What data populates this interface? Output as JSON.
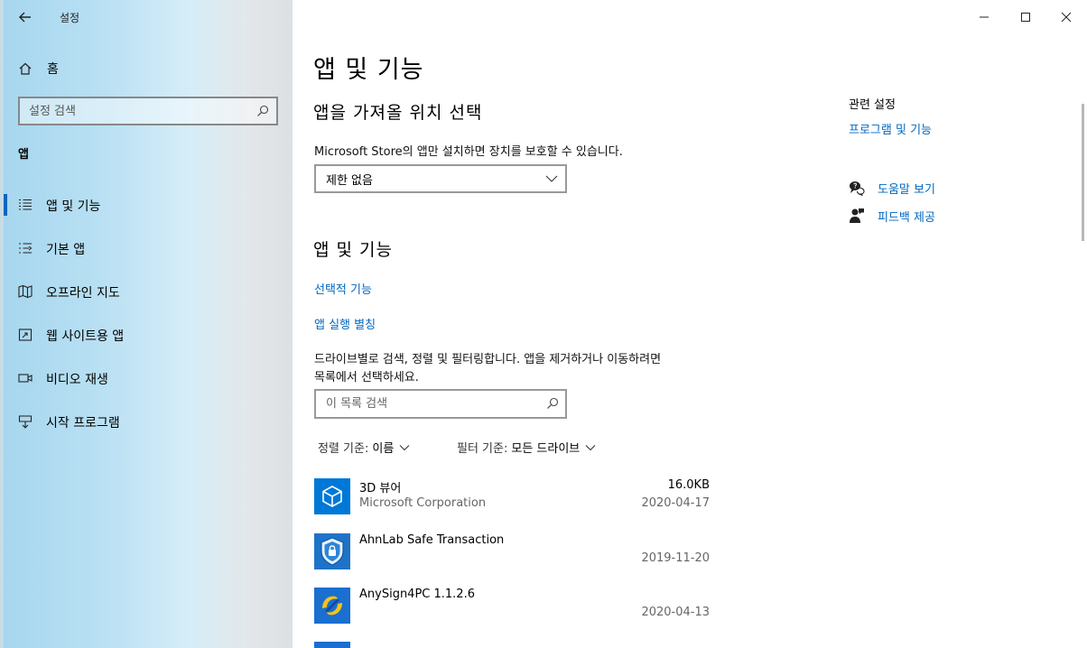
{
  "window": {
    "title": "설정",
    "controls": {
      "minimize": "minimize-icon",
      "maximize": "maximize-icon",
      "close": "close-icon"
    }
  },
  "sidebar": {
    "home_label": "홈",
    "search_placeholder": "설정 검색",
    "section_title": "앱",
    "items": [
      {
        "label": "앱 및 기능",
        "icon": "list-icon",
        "active": true
      },
      {
        "label": "기본 앱",
        "icon": "default-apps-icon",
        "active": false
      },
      {
        "label": "오프라인 지도",
        "icon": "map-icon",
        "active": false
      },
      {
        "label": "웹 사이트용 앱",
        "icon": "website-icon",
        "active": false
      },
      {
        "label": "비디오 재생",
        "icon": "video-icon",
        "active": false
      },
      {
        "label": "시작 프로그램",
        "icon": "startup-icon",
        "active": false
      }
    ]
  },
  "main": {
    "page_title": "앱 및 기능",
    "install_section": {
      "heading": "앱을 가져올 위치 선택",
      "description": "Microsoft Store의 앱만 설치하면 장치를 보호할 수 있습니다.",
      "dropdown_value": "제한 없음"
    },
    "apps_section": {
      "heading": "앱 및 기능",
      "link_optional": "선택적 기능",
      "link_aliases": "앱 실행 별칭",
      "description_line1": "드라이브별로 검색, 정렬 및 필터링합니다. 앱을 제거하거나 이동하려면",
      "description_line2": "목록에서 선택하세요.",
      "search_placeholder": "이 목록 검색",
      "sort_key": "정렬 기준:",
      "sort_value": "이름",
      "filter_key": "필터 기준:",
      "filter_value": "모든 드라이브",
      "apps": [
        {
          "name": "3D 뷰어",
          "publisher": "Microsoft Corporation",
          "size": "16.0KB",
          "date": "2020-04-17",
          "icon": "3d-viewer-icon",
          "color": "#0078d7"
        },
        {
          "name": "AhnLab Safe Transaction",
          "publisher": "",
          "size": "",
          "date": "2019-11-20",
          "icon": "ahnlab-shield-icon",
          "color": "#1e73c8"
        },
        {
          "name": "AnySign4PC 1.1.2.6",
          "publisher": "",
          "size": "",
          "date": "2020-04-13",
          "icon": "anysign-icon",
          "color": "#1a6fd0"
        }
      ]
    }
  },
  "related": {
    "title": "관련 설정",
    "programs_link": "프로그램 및 기능",
    "help_link": "도움말 보기",
    "feedback_link": "피드백 제공"
  }
}
